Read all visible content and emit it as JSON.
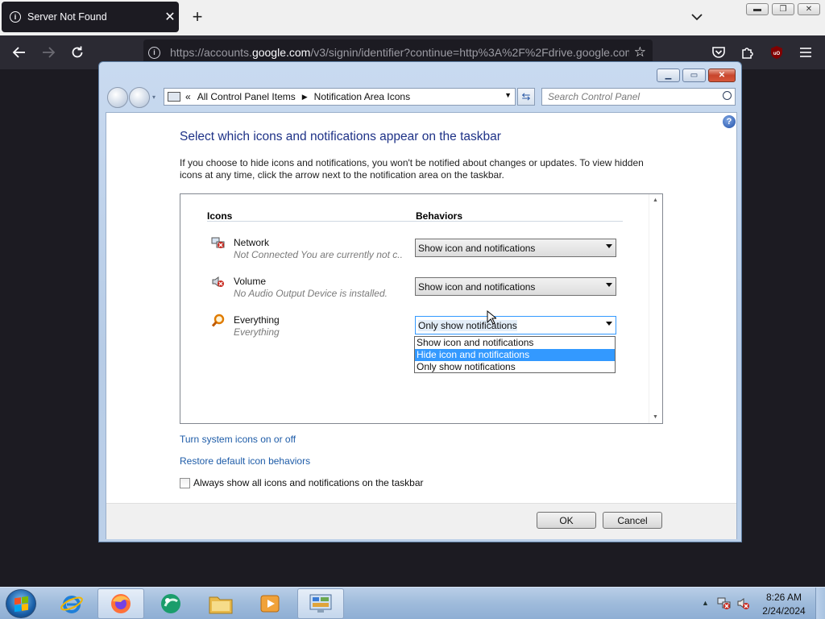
{
  "browser": {
    "tab_title": "Server Not Found",
    "url_prefix": "https://accounts.",
    "url_domain": "google.com",
    "url_suffix": "/v3/signin/identifier?continue=http%3A%2F%2Fdrive.google.com"
  },
  "window": {
    "breadcrumb": [
      "All Control Panel Items",
      "Notification Area Icons"
    ],
    "search_placeholder": "Search Control Panel"
  },
  "page": {
    "heading": "Select which icons and notifications appear on the taskbar",
    "description": "If you choose to hide icons and notifications, you won't be notified about changes or updates. To view hidden icons at any time, click the arrow next to the notification area on the taskbar.",
    "col_icons": "Icons",
    "col_behaviors": "Behaviors",
    "rows": [
      {
        "name": "Network",
        "desc": "Not Connected You are currently not c...",
        "behavior": "Show icon and notifications",
        "icon": "network-icon"
      },
      {
        "name": "Volume",
        "desc": "No Audio Output Device is installed.",
        "behavior": "Show icon and notifications",
        "icon": "volume-muted-icon"
      },
      {
        "name": "Everything",
        "desc": "Everything",
        "behavior": "Only show notifications",
        "icon": "everything-search-icon"
      }
    ],
    "dropdown_options": [
      "Show icon and notifications",
      "Hide icon and notifications",
      "Only show notifications"
    ],
    "dropdown_highlighted": "Hide icon and notifications",
    "link_system_icons": "Turn system icons on or off",
    "link_restore": "Restore default icon behaviors",
    "checkbox_label": "Always show all icons and notifications on the taskbar",
    "checkbox_checked": false,
    "ok_label": "OK",
    "cancel_label": "Cancel"
  },
  "taskbar": {
    "apps": [
      "internet-explorer-icon",
      "firefox-icon",
      "media-center-icon",
      "file-explorer-icon",
      "media-player-icon",
      "control-panel-icon"
    ],
    "time": "8:26 AM",
    "date": "2/24/2024"
  }
}
